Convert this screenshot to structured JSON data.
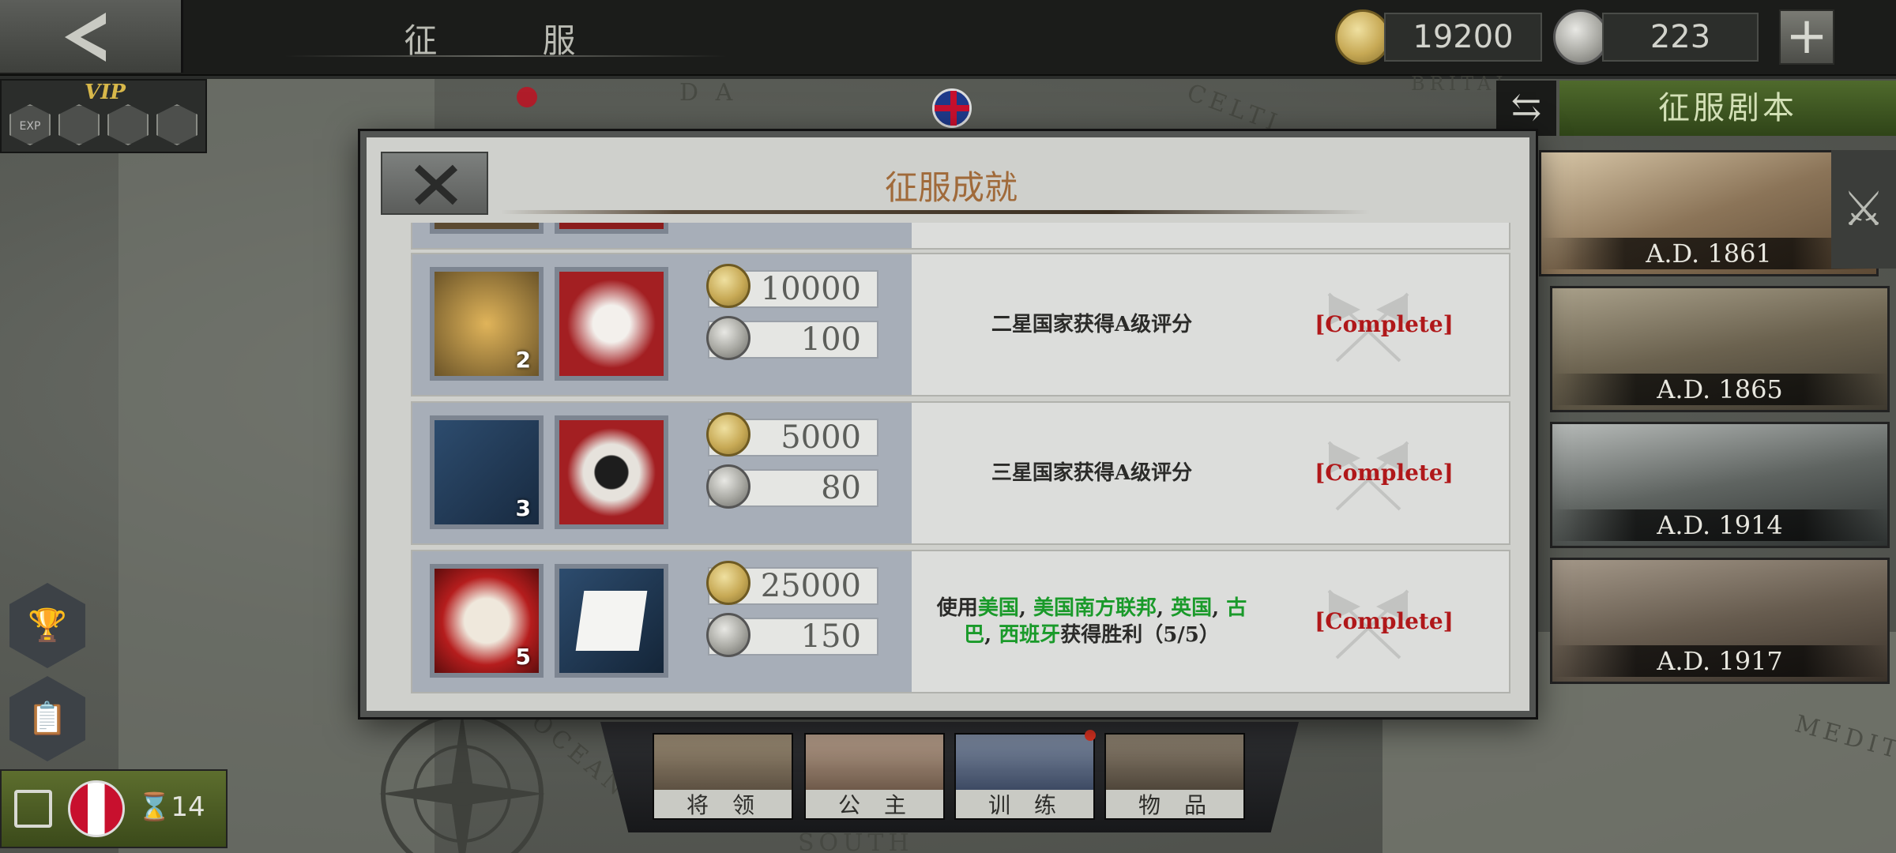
{
  "header": {
    "title": "征 服",
    "gold": "19200",
    "medals": "223",
    "plus_label": "+"
  },
  "vip": {
    "label": "VIP",
    "icons": [
      "EXP",
      "hat",
      "fort",
      "gear"
    ]
  },
  "map_labels": [
    "D  A",
    "BRITAI",
    "CELTI",
    "OCEAN",
    "SOUTH",
    "MEDITE"
  ],
  "right_panel": {
    "switch_label": "⇆",
    "header": "征服剧本",
    "scenarios": [
      {
        "year": "A.D. 1861"
      },
      {
        "year": "A.D. 1865"
      },
      {
        "year": "A.D. 1914"
      },
      {
        "year": "A.D. 1917"
      }
    ]
  },
  "bottom_nav": {
    "tabs": [
      {
        "label": "将领"
      },
      {
        "label": "公主"
      },
      {
        "label": "训练"
      },
      {
        "label": "物品"
      }
    ]
  },
  "save_bar": {
    "turn_count": "14"
  },
  "modal": {
    "title": "征服成就",
    "rows": [
      {
        "badge_count": "2",
        "gold_reward": "10000",
        "medal_reward": "100",
        "description": "二星国家获得A级评分",
        "status": "[Complete]"
      },
      {
        "badge_count": "3",
        "gold_reward": "5000",
        "medal_reward": "80",
        "description": "三星国家获得A级评分",
        "status": "[Complete]"
      },
      {
        "badge_count": "5",
        "gold_reward": "25000",
        "medal_reward": "150",
        "description_parts": {
          "prefix": "使用",
          "c1": "美国",
          "sep1": ", ",
          "c2": "美国南方联邦",
          "sep2": ", ",
          "c3": "英国",
          "sep3": ", ",
          "c4": "古巴",
          "sep4": ", ",
          "c5": "西班牙",
          "suffix": "获得胜利（5/5）"
        },
        "status": "[Complete]"
      }
    ]
  },
  "colors": {
    "status_complete": "#b0181a",
    "country_highlight": "#1a9a2a",
    "title_brown": "#a06a3a",
    "scenario_green": "#4f6a2c"
  }
}
